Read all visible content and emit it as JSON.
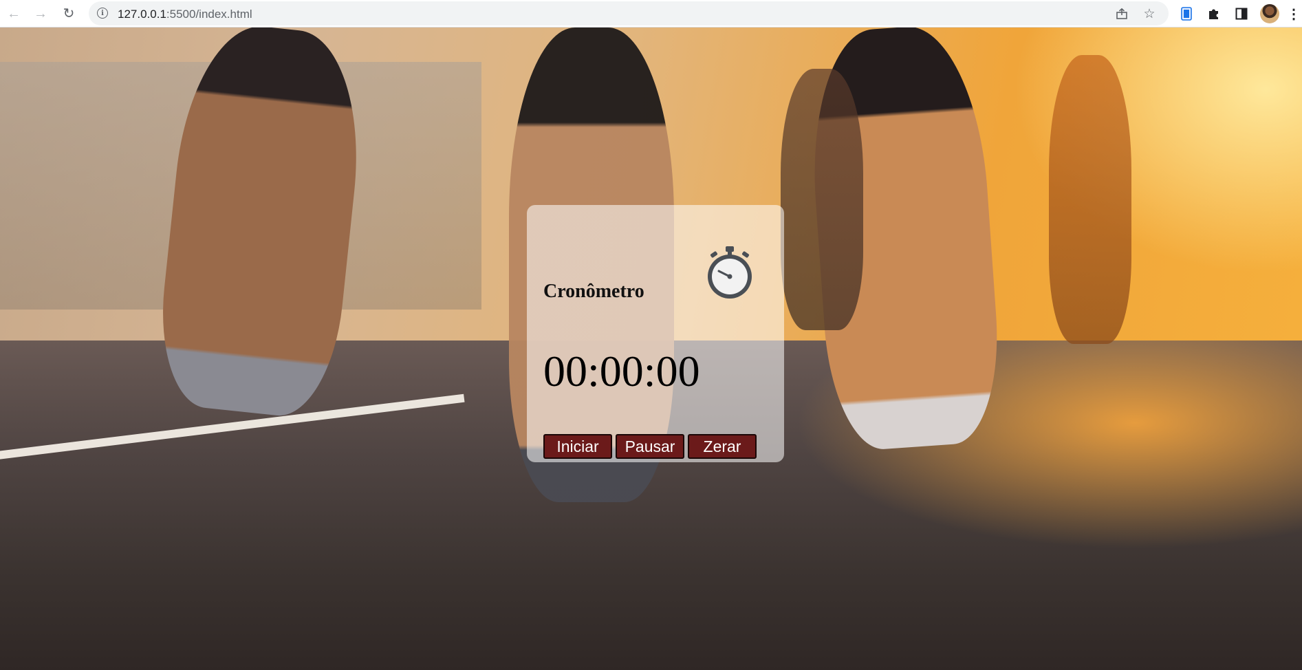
{
  "browser": {
    "url_host": "127.0.0.1",
    "url_path": ":5500/index.html",
    "icons": [
      "back-arrow-icon",
      "forward-arrow-icon",
      "reload-icon",
      "info-icon",
      "share-icon",
      "star-icon",
      "extension-icon",
      "puzzle-icon",
      "side-panel-icon",
      "profile-avatar",
      "menu-dots-icon"
    ]
  },
  "stopwatch": {
    "title": "Cronômetro",
    "time": "00:00:00",
    "buttons": {
      "start": "Iniciar",
      "pause": "Pausar",
      "reset": "Zerar"
    },
    "icon": "stopwatch-icon"
  },
  "colors": {
    "button_bg": "#6b1a1a",
    "card_bg": "rgba(255,255,255,0.55)",
    "sunset_accent": "#f0a53a"
  }
}
